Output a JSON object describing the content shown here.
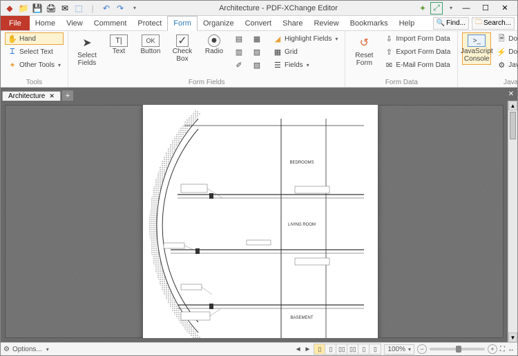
{
  "window": {
    "title": "Architecture - PDF-XChange Editor"
  },
  "qat": {
    "undo": "↶",
    "redo": "↷"
  },
  "menu": {
    "file": "File",
    "tabs": [
      "Home",
      "View",
      "Comment",
      "Protect",
      "Form",
      "Organize",
      "Convert",
      "Share",
      "Review",
      "Bookmarks",
      "Help"
    ],
    "active": "Form",
    "find": "Find...",
    "search": "Search..."
  },
  "ribbon": {
    "tools": {
      "label": "Tools",
      "hand": "Hand",
      "select_text": "Select Text",
      "other": "Other Tools"
    },
    "formfields": {
      "label": "Form Fields",
      "select_fields": "Select Fields",
      "text": "Text",
      "button": "Button",
      "checkbox": "Check Box",
      "radio": "Radio",
      "highlight": "Highlight Fields",
      "grid": "Grid",
      "fields": "Fields"
    },
    "formdata": {
      "label": "Form Data",
      "reset": "Reset Form",
      "import": "Import Form Data",
      "export": "Export Form Data",
      "email": "E-Mail Form Data"
    },
    "javascript": {
      "label": "JavaScript",
      "console": "JavaScript Console",
      "docjs": "Document JavaScript",
      "actions": "Document Actions",
      "options": "JavaScript Options"
    }
  },
  "doc": {
    "tabname": "Architecture"
  },
  "drawing": {
    "bedrooms": "BEDROOMS",
    "living": "LIVING ROOM",
    "basement": "BASEMENT"
  },
  "status": {
    "options": "Options...",
    "zoom": "100%"
  }
}
